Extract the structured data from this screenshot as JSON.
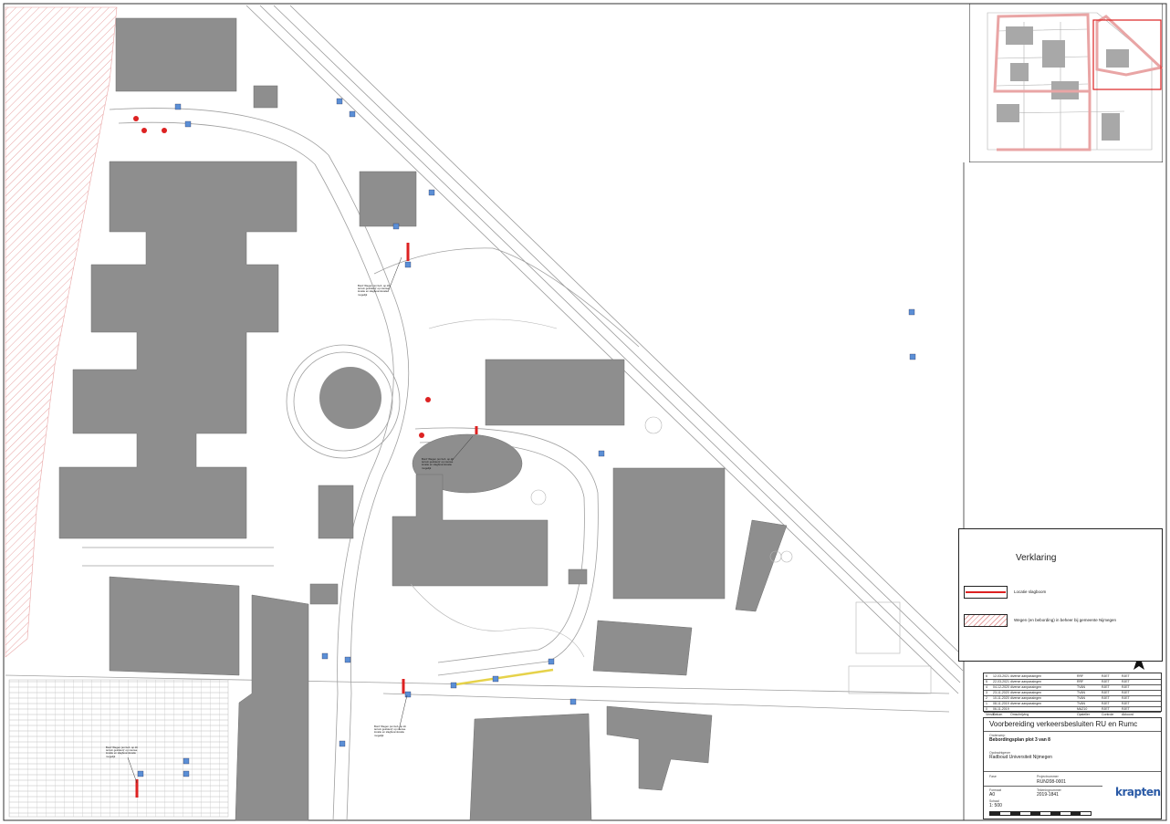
{
  "legend": {
    "title": "Verklaring",
    "items": [
      {
        "label": "Locatie slagboom",
        "color": "#dd2222"
      },
      {
        "label": "Wegen (en bebording) in beheer bij gemeente Nijmegen",
        "color": "#e9a5a5"
      }
    ]
  },
  "revisions": [
    {
      "nr": "6",
      "date": "12-03-2021",
      "desc": "diverse aanpassingen",
      "drawn": "RRF",
      "checked": "RJET",
      "approved": "RJET"
    },
    {
      "nr": "5",
      "date": "22-03-2021",
      "desc": "diverse aanpassingen",
      "drawn": "RRF",
      "checked": "RJET",
      "approved": "RJET"
    },
    {
      "nr": "4",
      "date": "04-12-2020",
      "desc": "diverse aanpassingen",
      "drawn": "TVAN",
      "checked": "RJET",
      "approved": "RJET"
    },
    {
      "nr": "3",
      "date": "23-11-2020",
      "desc": "diverse aanpassingen",
      "drawn": "TVAN",
      "checked": "RJET",
      "approved": "RJET"
    },
    {
      "nr": "2",
      "date": "10-11-2020",
      "desc": "diverse aanpassingen",
      "drawn": "TVAN",
      "checked": "RJET",
      "approved": "RJET"
    },
    {
      "nr": "1",
      "date": "08-11-2019",
      "desc": "diverse aanpassingen",
      "drawn": "TVAN",
      "checked": "RJET",
      "approved": "RJET"
    },
    {
      "nr": "0",
      "date": "06-11-2019",
      "desc": "",
      "drawn": "MAZ10",
      "checked": "RJET",
      "approved": "RJET"
    }
  ],
  "revision_header": {
    "nr": "Versie",
    "date": "Datum",
    "desc": "Omschrijving",
    "drawn": "Opsteller",
    "checked": "Controle",
    "approved": "Akkoord"
  },
  "titleblock": {
    "project": "Voorbereiding verkeersbesluiten RU en Rumc",
    "subject_label": "Onderwerp",
    "subject": "Bebordingsplan plot 3 van 8",
    "client_label": "Opdrachtgever",
    "client": "Radboud Universiteit Nijmegen",
    "phase_label": "Fase",
    "project_nr_label": "Projectnummer",
    "project_nr": "RUN208-0001",
    "format_label": "Formaat",
    "format": "A0",
    "drawing_nr_label": "Tekeningnummer",
    "drawing_nr": "2019-1841",
    "scale_label": "Schaal",
    "scale": "1: 500",
    "company": "krapten"
  },
  "annotations": [
    "Bord 'Wegen (en beh. op dit terrein gesloten)' op nieuwe locatie en slagboomlocatie mogelijk",
    "Bord 'Wegen (en beh. op dit terrein gesloten)' op nieuwe locatie en slagboomlocatie mogelijk",
    "Bord 'Wegen (en beh. op dit terrein gesloten)' op nieuwe locatie en slagboomlocatie mogelijk",
    "Bord 'Wegen (en beh. op dit terrein gesloten)' op nieuwe locatie en slagboomlocatie mogelijk"
  ],
  "colors": {
    "building": "#8e8e8e",
    "road_line": "#9a9a9a",
    "barrier": "#dd2222",
    "sign": "#5b8fd6",
    "hatch": "#e9a5a5",
    "highlight": "#e6d24a"
  }
}
